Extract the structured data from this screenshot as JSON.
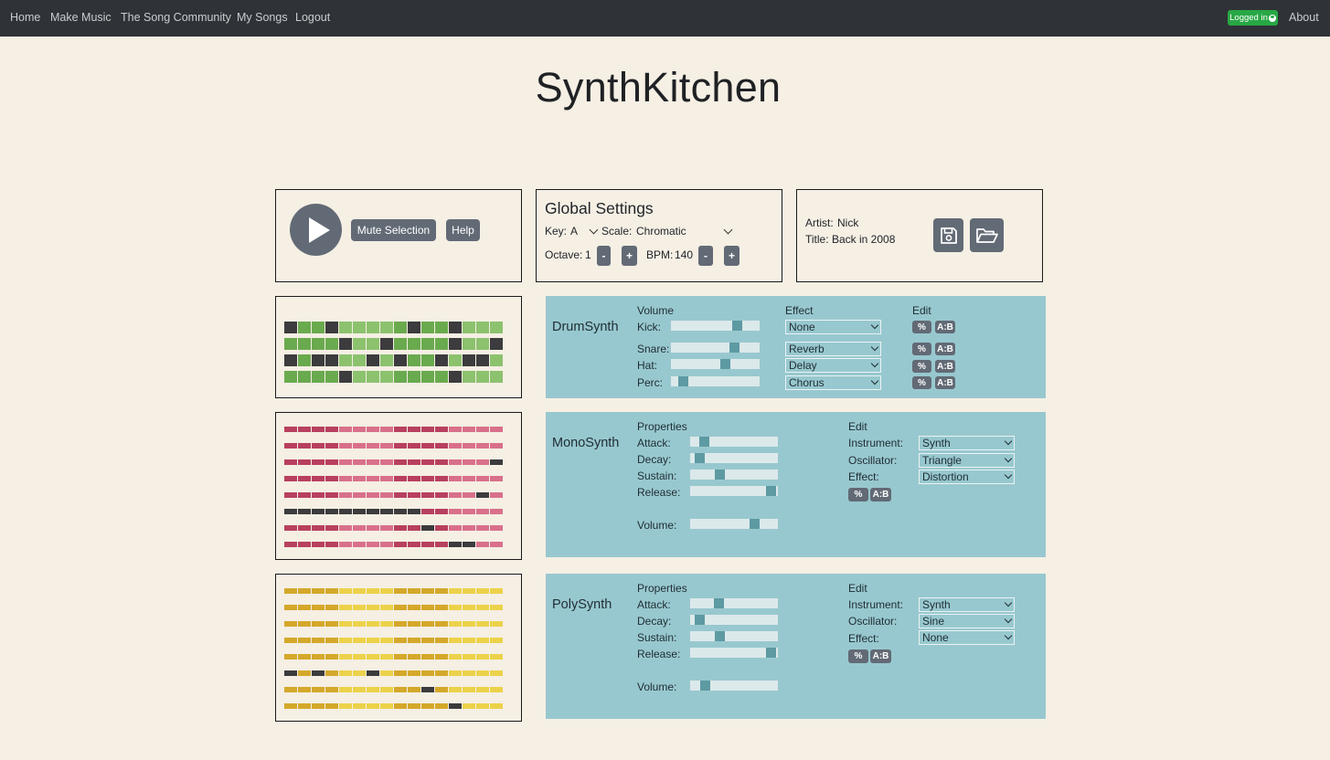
{
  "nav": {
    "links": [
      "Home",
      "Make Music",
      "The Song Community",
      "My Songs",
      "Logout"
    ],
    "logged_in": "Logged in",
    "about": "About"
  },
  "app_title": "SynthKitchen",
  "transport": {
    "mute_label": "Mute Selection",
    "help_label": "Help"
  },
  "global": {
    "heading": "Global Settings",
    "key_label": "Key:",
    "key_value": "A",
    "scale_label": "Scale:",
    "scale_value": "Chromatic",
    "octave_label": "Octave:",
    "octave_value": "1",
    "bpm_label": "BPM:",
    "bpm_value": "140",
    "minus": "-",
    "plus": "+"
  },
  "song": {
    "artist_label": "Artist:",
    "artist": "Nick",
    "title_label": "Title:",
    "title": "Back in 2008"
  },
  "colors": {
    "drum_on": "#6aaa4e",
    "drum_off": "#8cc26e",
    "mono_on": "#b8405e",
    "mono_off": "#d9708a",
    "poly_on": "#d4a82a",
    "poly_off": "#ecd24a",
    "active": "#3c3b3d",
    "synth_panel": "#98c8cf"
  },
  "sequencer": {
    "drum": [
      [
        1,
        0,
        0,
        1,
        0,
        0,
        0,
        0,
        0,
        1,
        0,
        0,
        1,
        0,
        0,
        0
      ],
      [
        0,
        0,
        0,
        0,
        1,
        0,
        0,
        1,
        0,
        0,
        0,
        0,
        1,
        0,
        0,
        1
      ],
      [
        1,
        0,
        1,
        1,
        0,
        0,
        1,
        0,
        1,
        0,
        0,
        1,
        0,
        1,
        1,
        0
      ],
      [
        0,
        0,
        0,
        0,
        1,
        0,
        0,
        0,
        0,
        0,
        0,
        0,
        1,
        0,
        0,
        0
      ]
    ],
    "mono": [
      [
        0,
        0,
        0,
        0,
        0,
        0,
        0,
        0,
        0,
        0,
        0,
        0,
        0,
        0,
        0,
        0
      ],
      [
        0,
        0,
        0,
        0,
        0,
        0,
        0,
        0,
        0,
        0,
        0,
        0,
        0,
        0,
        0,
        0
      ],
      [
        0,
        0,
        0,
        0,
        0,
        0,
        0,
        0,
        0,
        0,
        0,
        0,
        0,
        0,
        0,
        1
      ],
      [
        0,
        0,
        0,
        0,
        0,
        0,
        0,
        0,
        0,
        0,
        0,
        0,
        0,
        0,
        0,
        0
      ],
      [
        0,
        0,
        0,
        0,
        0,
        0,
        0,
        0,
        0,
        0,
        0,
        0,
        0,
        0,
        1,
        0
      ],
      [
        1,
        1,
        1,
        1,
        1,
        1,
        1,
        1,
        1,
        1,
        0,
        0,
        0,
        0,
        0,
        0
      ],
      [
        0,
        0,
        0,
        0,
        0,
        0,
        0,
        0,
        0,
        0,
        1,
        0,
        0,
        0,
        0,
        0
      ],
      [
        0,
        0,
        0,
        0,
        0,
        0,
        0,
        0,
        0,
        0,
        0,
        0,
        1,
        1,
        0,
        0
      ]
    ],
    "poly": [
      [
        0,
        0,
        0,
        0,
        0,
        0,
        0,
        0,
        0,
        0,
        0,
        0,
        0,
        0,
        0,
        0
      ],
      [
        0,
        0,
        0,
        0,
        0,
        0,
        0,
        0,
        0,
        0,
        0,
        0,
        0,
        0,
        0,
        0
      ],
      [
        0,
        0,
        0,
        0,
        0,
        0,
        0,
        0,
        0,
        0,
        0,
        0,
        0,
        0,
        0,
        0
      ],
      [
        0,
        0,
        0,
        0,
        0,
        0,
        0,
        0,
        0,
        0,
        0,
        0,
        0,
        0,
        0,
        0
      ],
      [
        0,
        0,
        0,
        0,
        0,
        0,
        0,
        0,
        0,
        0,
        0,
        0,
        0,
        0,
        0,
        0
      ],
      [
        1,
        0,
        1,
        0,
        0,
        0,
        1,
        0,
        0,
        0,
        0,
        0,
        0,
        0,
        0,
        0
      ],
      [
        0,
        0,
        0,
        0,
        0,
        0,
        0,
        0,
        0,
        0,
        1,
        0,
        0,
        0,
        0,
        0
      ],
      [
        0,
        0,
        0,
        0,
        0,
        0,
        0,
        0,
        0,
        0,
        0,
        0,
        1,
        0,
        0,
        0
      ]
    ]
  },
  "drumsynth": {
    "name": "DrumSynth",
    "volume_header": "Volume",
    "effect_header": "Effect",
    "edit_header": "Edit",
    "rows": [
      {
        "label": "Kick:",
        "volume": 0.78,
        "effect": "None"
      },
      {
        "label": "Snare:",
        "volume": 0.74,
        "effect": "Reverb"
      },
      {
        "label": "Hat:",
        "volume": 0.63,
        "effect": "Delay"
      },
      {
        "label": "Perc:",
        "volume": 0.09,
        "effect": "Chorus"
      }
    ],
    "pct": "%",
    "ab": "A:B"
  },
  "monosynth": {
    "name": "MonoSynth",
    "properties_header": "Properties",
    "edit_header": "Edit",
    "attack_label": "Attack:",
    "attack": 0.12,
    "decay_label": "Decay:",
    "decay": 0.06,
    "sustain_label": "Sustain:",
    "sustain": 0.32,
    "release_label": "Release:",
    "release": 0.98,
    "volume_label": "Volume:",
    "volume": 0.77,
    "instrument_label": "Instrument:",
    "instrument": "Synth",
    "oscillator_label": "Oscillator:",
    "oscillator": "Triangle",
    "effect_label": "Effect:",
    "effect": "Distortion",
    "pct": "%",
    "ab": "A:B"
  },
  "polysynth": {
    "name": "PolySynth",
    "properties_header": "Properties",
    "edit_header": "Edit",
    "attack_label": "Attack:",
    "attack": 0.3,
    "decay_label": "Decay:",
    "decay": 0.06,
    "sustain_label": "Sustain:",
    "sustain": 0.32,
    "release_label": "Release:",
    "release": 0.98,
    "volume_label": "Volume:",
    "volume": 0.13,
    "instrument_label": "Instrument:",
    "instrument": "Synth",
    "oscillator_label": "Oscillator:",
    "oscillator": "Sine",
    "effect_label": "Effect:",
    "effect": "None",
    "pct": "%",
    "ab": "A:B"
  }
}
